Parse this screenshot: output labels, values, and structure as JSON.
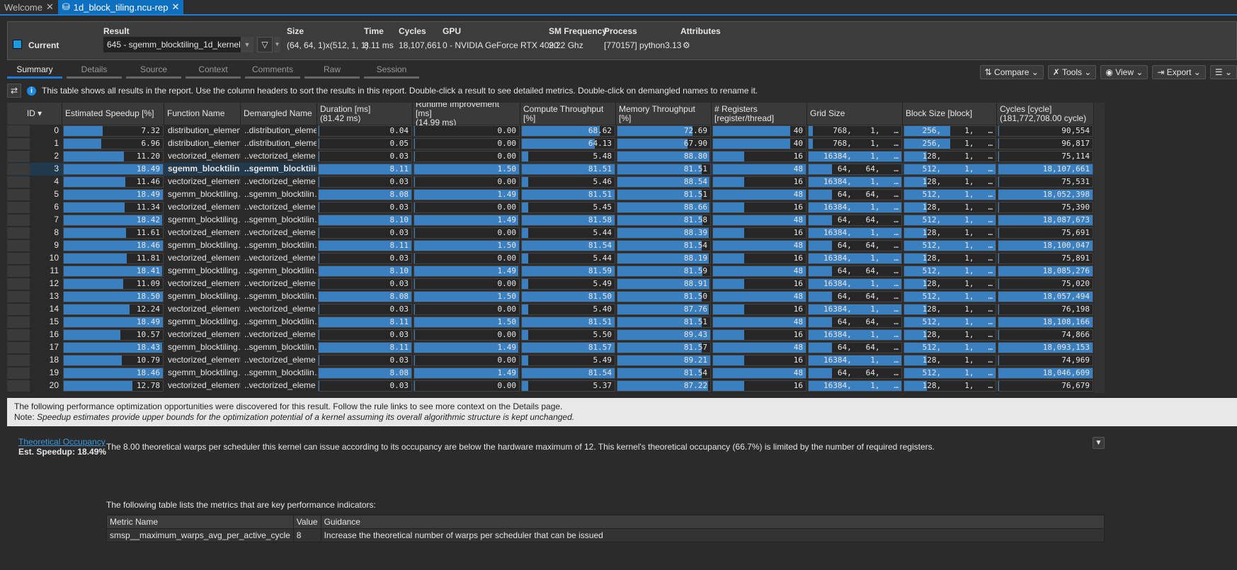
{
  "tabs": [
    {
      "label": "Welcome"
    },
    {
      "label": "1d_block_tiling.ncu-rep"
    }
  ],
  "header": {
    "current_label": "Current",
    "current_color": "#1a9ae0",
    "result_label": "Result",
    "result_value": "645 - sgemm_blocktiling_1d_kernel",
    "size_label": "Size",
    "size_value": "(64, 64, 1)x(512, 1, 1)",
    "time_label": "Time",
    "time_value": "8.11 ms",
    "cycles_label": "Cycles",
    "cycles_value": "18,107,661",
    "gpu_label": "GPU",
    "gpu_value": "0 - NVIDIA GeForce RTX 4090",
    "smfreq_label": "SM Frequency",
    "smfreq_value": "2.22 Ghz",
    "process_label": "Process",
    "process_value": "[770157] python3.13",
    "attributes_label": "Attributes"
  },
  "page_tabs": [
    "Summary",
    "Details",
    "Source",
    "Context",
    "Comments",
    "Raw",
    "Session"
  ],
  "toolbar": {
    "compare": "Compare",
    "tools": "Tools",
    "view": "View",
    "export": "Export"
  },
  "info_text": "This table shows all results in the report. Use the column headers to sort the results in this report. Double-click a result to see detailed metrics. Double-click on demangled names to rename it.",
  "columns": [
    "ID",
    "Estimated Speedup [%]",
    "Function Name",
    "Demangled Name",
    "Duration [ms]\n(81.42 ms)",
    "Runtime Improvement [ms]\n(14.99 ms)",
    "Compute Throughput [%]",
    "Memory Throughput [%]",
    "# Registers [register/thread]",
    "Grid Size",
    "Block Size [block]",
    "Cycles [cycle]\n(181,772,708.00 cycle)"
  ],
  "selected_id": 3,
  "rows": [
    [
      0,
      7.32,
      "distribution_elemen…",
      "..distribution_eleme…",
      "0.04",
      "0.00",
      68.62,
      72.69,
      40,
      "768,",
      "1,",
      "256,",
      "1,",
      "90,554"
    ],
    [
      1,
      6.96,
      "distribution_elemen…",
      "..distribution_eleme…",
      "0.05",
      "0.00",
      64.13,
      67.9,
      40,
      "768,",
      "1,",
      "256,",
      "1,",
      "96,817"
    ],
    [
      2,
      11.2,
      "vectorized_element…",
      "..vectorized_eleme…",
      "0.03",
      "0.00",
      5.48,
      88.8,
      16,
      "16384,",
      "1,",
      "128,",
      "1,",
      "75,114"
    ],
    [
      3,
      18.49,
      "sgemm_blocktiling…",
      "..sgemm_blocktilin…",
      "8.11",
      "1.50",
      81.51,
      81.51,
      48,
      "64,",
      "64,",
      "512,",
      "1,",
      "18,107,661"
    ],
    [
      4,
      11.46,
      "vectorized_element…",
      "..vectorized_eleme…",
      "0.03",
      "0.00",
      5.46,
      88.54,
      16,
      "16384,",
      "1,",
      "128,",
      "1,",
      "75,531"
    ],
    [
      5,
      18.49,
      "sgemm_blocktiling…",
      "..sgemm_blocktilin…",
      "8.08",
      "1.49",
      81.51,
      81.51,
      48,
      "64,",
      "64,",
      "512,",
      "1,",
      "18,052,398"
    ],
    [
      6,
      11.34,
      "vectorized_element…",
      "..vectorized_eleme…",
      "0.03",
      "0.00",
      5.45,
      88.66,
      16,
      "16384,",
      "1,",
      "128,",
      "1,",
      "75,390"
    ],
    [
      7,
      18.42,
      "sgemm_blocktiling…",
      "..sgemm_blocktilin…",
      "8.10",
      "1.49",
      81.58,
      81.58,
      48,
      "64,",
      "64,",
      "512,",
      "1,",
      "18,087,673"
    ],
    [
      8,
      11.61,
      "vectorized_element…",
      "..vectorized_eleme…",
      "0.03",
      "0.00",
      5.44,
      88.39,
      16,
      "16384,",
      "1,",
      "128,",
      "1,",
      "75,691"
    ],
    [
      9,
      18.46,
      "sgemm_blocktiling…",
      "..sgemm_blocktilin…",
      "8.11",
      "1.50",
      81.54,
      81.54,
      48,
      "64,",
      "64,",
      "512,",
      "1,",
      "18,100,047"
    ],
    [
      10,
      11.81,
      "vectorized_element…",
      "..vectorized_eleme…",
      "0.03",
      "0.00",
      5.44,
      88.19,
      16,
      "16384,",
      "1,",
      "128,",
      "1,",
      "75,891"
    ],
    [
      11,
      18.41,
      "sgemm_blocktiling…",
      "..sgemm_blocktilin…",
      "8.10",
      "1.49",
      81.59,
      81.59,
      48,
      "64,",
      "64,",
      "512,",
      "1,",
      "18,085,276"
    ],
    [
      12,
      11.09,
      "vectorized_element…",
      "..vectorized_eleme…",
      "0.03",
      "0.00",
      5.49,
      88.91,
      16,
      "16384,",
      "1,",
      "128,",
      "1,",
      "75,020"
    ],
    [
      13,
      18.5,
      "sgemm_blocktiling…",
      "..sgemm_blocktilin…",
      "8.08",
      "1.50",
      81.5,
      81.5,
      48,
      "64,",
      "64,",
      "512,",
      "1,",
      "18,057,494"
    ],
    [
      14,
      12.24,
      "vectorized_element…",
      "..vectorized_eleme…",
      "0.03",
      "0.00",
      5.4,
      87.76,
      16,
      "16384,",
      "1,",
      "128,",
      "1,",
      "76,198"
    ],
    [
      15,
      18.49,
      "sgemm_blocktiling…",
      "..sgemm_blocktilin…",
      "8.11",
      "1.50",
      81.51,
      81.51,
      48,
      "64,",
      "64,",
      "512,",
      "1,",
      "18,108,166"
    ],
    [
      16,
      10.57,
      "vectorized_element…",
      "..vectorized_eleme…",
      "0.03",
      "0.00",
      5.5,
      89.43,
      16,
      "16384,",
      "1,",
      "128,",
      "1,",
      "74,866"
    ],
    [
      17,
      18.43,
      "sgemm_blocktiling…",
      "..sgemm_blocktilin…",
      "8.11",
      "1.49",
      81.57,
      81.57,
      48,
      "64,",
      "64,",
      "512,",
      "1,",
      "18,093,153"
    ],
    [
      18,
      10.79,
      "vectorized_element…",
      "..vectorized_eleme…",
      "0.03",
      "0.00",
      5.49,
      89.21,
      16,
      "16384,",
      "1,",
      "128,",
      "1,",
      "74,969"
    ],
    [
      19,
      18.46,
      "sgemm_blocktiling…",
      "..sgemm_blocktilin…",
      "8.08",
      "1.49",
      81.54,
      81.54,
      48,
      "64,",
      "64,",
      "512,",
      "1,",
      "18,046,609"
    ],
    [
      20,
      12.78,
      "vectorized_element…",
      "..vectorized_eleme…",
      "0.03",
      "0.00",
      5.37,
      87.22,
      16,
      "16384,",
      "1,",
      "128,",
      "1,",
      "76,679"
    ]
  ],
  "note": {
    "line1": "The following performance optimization opportunities were discovered for this result. Follow the rule links to see more context on the Details page.",
    "prefix": "Note: ",
    "line2": "Speedup estimates provide upper bounds for the optimization potential of a kernel assuming its overall algorithmic structure is kept unchanged."
  },
  "rule": {
    "name": "Theoretical Occupancy",
    "speedup": "Est. Speedup: 18.49%",
    "text": "The 8.00 theoretical warps per scheduler this kernel can issue according to its occupancy are below the hardware maximum of 12. This kernel's theoretical occupancy (66.7%) is limited by the number of required registers.",
    "kpi_intro": "The following table lists the metrics that are key performance indicators:",
    "kpi_headers": [
      "Metric Name",
      "Value",
      "Guidance"
    ],
    "kpi_row": [
      "smsp__maximum_warps_avg_per_active_cycle",
      "8",
      "Increase the theoretical number of warps per scheduler that can be issued"
    ]
  }
}
